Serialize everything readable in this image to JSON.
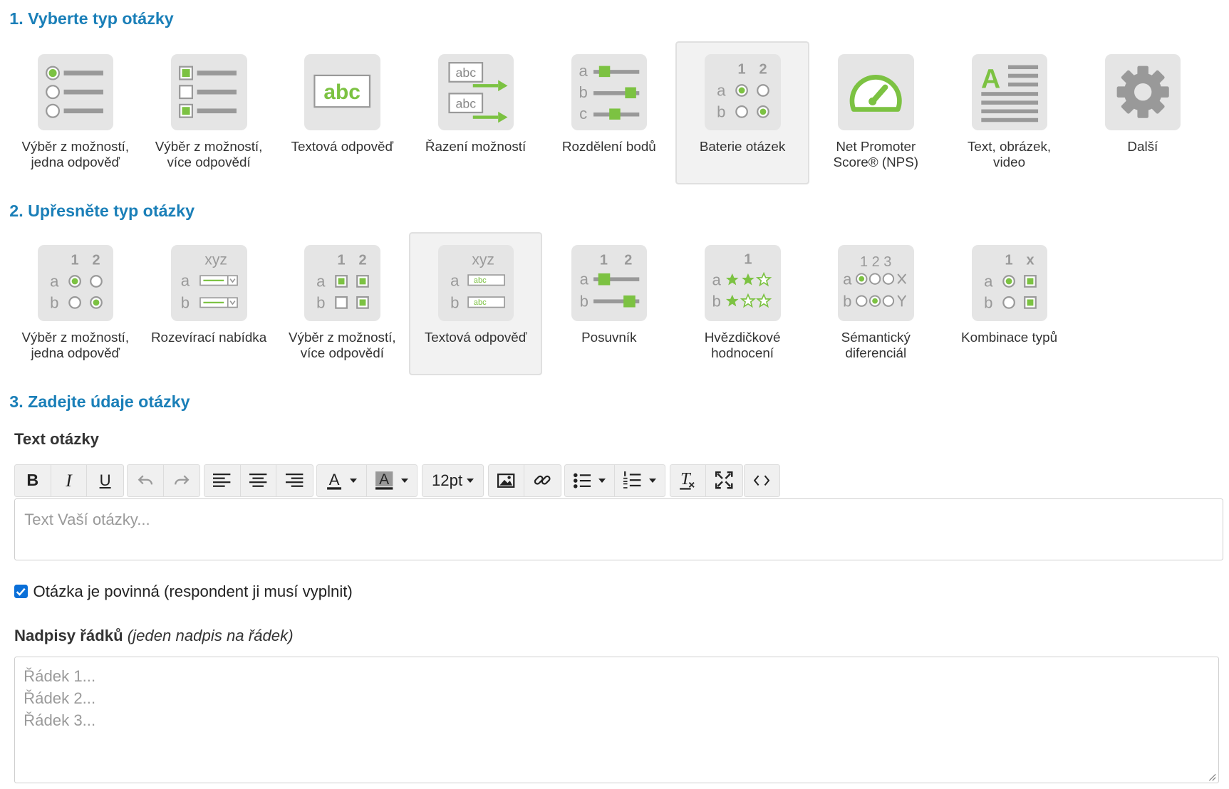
{
  "sections": {
    "s1": "1. Vyberte typ otázky",
    "s2": "2. Upřesněte typ otázky",
    "s3": "3. Zadejte údaje otázky"
  },
  "question_types": [
    {
      "label": "Výběr z možností,\njedna odpověď",
      "icon": "single-choice-icon",
      "selected": false
    },
    {
      "label": "Výběr z možností,\nvíce odpovědí",
      "icon": "multiple-choice-icon",
      "selected": false
    },
    {
      "label": "Textová odpověď",
      "icon": "text-answer-icon",
      "icon_text": "abc",
      "selected": false
    },
    {
      "label": "Řazení možností",
      "icon": "ranking-icon",
      "icon_text": "abc",
      "selected": false
    },
    {
      "label": "Rozdělení bodů",
      "icon": "point-distribution-icon",
      "selected": false
    },
    {
      "label": "Baterie otázek",
      "icon": "question-battery-icon",
      "selected": true
    },
    {
      "label": "Net Promoter\nScore® (NPS)",
      "icon": "gauge-icon",
      "selected": false
    },
    {
      "label": "Text, obrázek,\nvideo",
      "icon": "text-image-icon",
      "icon_text": "A",
      "selected": false
    },
    {
      "label": "Další",
      "icon": "gear-icon",
      "selected": false
    }
  ],
  "subtypes": [
    {
      "label": "Výběr z možností,\njedna odpověď",
      "icon": "battery-single-choice-icon",
      "selected": false
    },
    {
      "label": "Rozevírací nabídka",
      "icon": "dropdown-icon",
      "icon_text": "xyz",
      "selected": false
    },
    {
      "label": "Výběr z možností,\nvíce odpovědí",
      "icon": "battery-multiple-choice-icon",
      "selected": false
    },
    {
      "label": "Textová odpověď",
      "icon": "battery-text-icon",
      "icon_text": "xyz",
      "field_text": "abc",
      "selected": true
    },
    {
      "label": "Posuvník",
      "icon": "slider-icon",
      "selected": false
    },
    {
      "label": "Hvězdičkové\nhodnocení",
      "icon": "star-rating-icon",
      "selected": false
    },
    {
      "label": "Sémantický\ndiferenciál",
      "icon": "semantic-differential-icon",
      "icon_text": "1 2 3",
      "selected": false
    },
    {
      "label": "Kombinace typů",
      "icon": "combination-icon",
      "icon_text": "x",
      "selected": false
    }
  ],
  "icon_letters": {
    "a": "a",
    "b": "b",
    "c": "c",
    "one": "1",
    "two": "2"
  },
  "editor": {
    "label": "Text otázky",
    "font_size": "12pt",
    "placeholder": "Text Vaší otázky..."
  },
  "required": {
    "label": "Otázka je povinná (respondent ji musí vyplnit)",
    "checked": true
  },
  "rows": {
    "label": "Nadpisy řádků",
    "hint": "(jeden nadpis na řádek)",
    "placeholders": [
      "Řádek 1...",
      "Řádek 2...",
      "Řádek 3..."
    ]
  },
  "colors": {
    "accent": "#1a7fb8",
    "green": "#7cc242",
    "icon_gray": "#999999",
    "tile_bg": "#e5e5e5"
  }
}
